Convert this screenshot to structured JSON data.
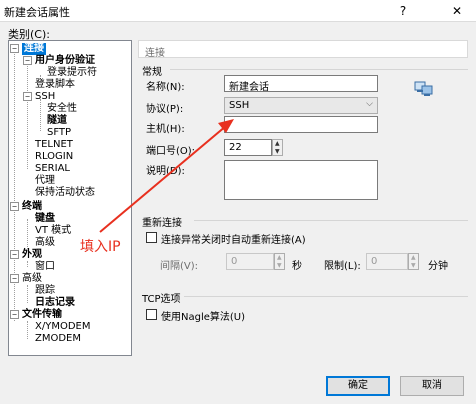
{
  "window": {
    "title": "新建会话属性",
    "help_label": "?",
    "close_label": "✕"
  },
  "category_label": "类别(C):",
  "tree": {
    "items": [
      {
        "label": "连接",
        "bold": true,
        "selected": true
      },
      {
        "label": "用户身份验证",
        "bold": true
      },
      {
        "label": "登录提示符"
      },
      {
        "label": "登录脚本"
      },
      {
        "label": "SSH"
      },
      {
        "label": "安全性"
      },
      {
        "label": "隧道",
        "bold": true
      },
      {
        "label": "SFTP"
      },
      {
        "label": "TELNET"
      },
      {
        "label": "RLOGIN"
      },
      {
        "label": "SERIAL"
      },
      {
        "label": "代理"
      },
      {
        "label": "保持活动状态"
      },
      {
        "label": "终端",
        "bold": true
      },
      {
        "label": "键盘",
        "bold": true
      },
      {
        "label": "VT 模式"
      },
      {
        "label": "高级"
      },
      {
        "label": "外观",
        "bold": true
      },
      {
        "label": "窗口"
      },
      {
        "label": "高级"
      },
      {
        "label": "跟踪"
      },
      {
        "label": "日志记录",
        "bold": true
      },
      {
        "label": "文件传输",
        "bold": true
      },
      {
        "label": "X/YMODEM"
      },
      {
        "label": "ZMODEM"
      }
    ],
    "expanders": [
      "−",
      "−",
      "−",
      "−",
      "−",
      "−",
      "−"
    ]
  },
  "panel": {
    "header": "连接",
    "general_section": "常规",
    "name_label": "名称(N):",
    "name_value": "新建会话",
    "protocol_label": "协议(P):",
    "protocol_value": "SSH",
    "host_label": "主机(H):",
    "host_value": "",
    "port_label": "端口号(O):",
    "port_value": "22",
    "desc_label": "说明(D):",
    "reconnect_section": "重新连接",
    "reconnect_checkbox": "连接异常关闭时自动重新连接(A)",
    "interval_label": "间隔(V):",
    "interval_value": "0",
    "interval_unit": "秒",
    "limit_label": "限制(L):",
    "limit_value": "0",
    "limit_unit": "分钟",
    "tcp_section": "TCP选项",
    "nagle_checkbox": "使用Nagle算法(U)"
  },
  "annotation": {
    "text": "填入IP",
    "color": "#e8301f"
  },
  "buttons": {
    "ok": "确定",
    "cancel": "取消"
  },
  "icons": {
    "network": "network-computers-icon",
    "dropdown": "chevron-down-icon"
  }
}
